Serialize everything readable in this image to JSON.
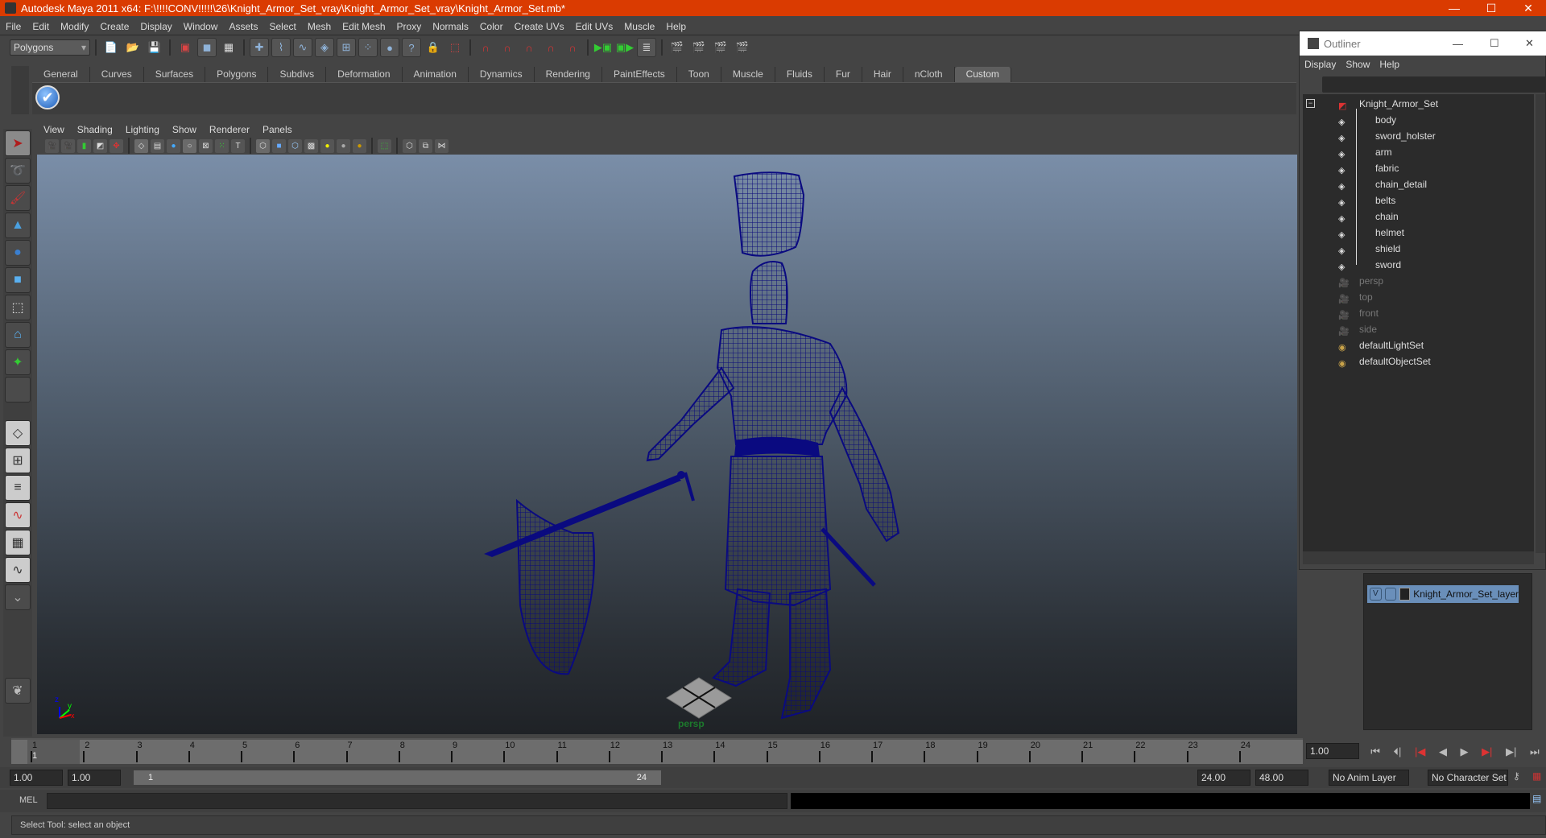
{
  "window": {
    "title": "Autodesk Maya 2011 x64: F:\\!!!!CONV!!!!!\\26\\Knight_Armor_Set_vray\\Knight_Armor_Set_vray\\Knight_Armor_Set.mb*",
    "minimize": "—",
    "maximize": "☐",
    "close": "✕"
  },
  "menubar": [
    "File",
    "Edit",
    "Modify",
    "Create",
    "Display",
    "Window",
    "Assets",
    "Select",
    "Mesh",
    "Edit Mesh",
    "Proxy",
    "Normals",
    "Color",
    "Create UVs",
    "Edit UVs",
    "Muscle",
    "Help"
  ],
  "toolbar": {
    "mode_select": "Polygons",
    "icons": [
      "new-scene",
      "open-scene",
      "save-scene",
      "select-by-hierarchy",
      "select-by-object-type",
      "select-by-component-type",
      "snap-to-grids",
      "snap-to-curves",
      "snap-to-points",
      "snap-to-view-planes",
      "make-live",
      "history",
      "render-current",
      "ipr-render",
      "render-settings",
      "hypershade"
    ]
  },
  "shelf": {
    "tabs": [
      "General",
      "Curves",
      "Surfaces",
      "Polygons",
      "Subdivs",
      "Deformation",
      "Animation",
      "Dynamics",
      "Rendering",
      "PaintEffects",
      "Toon",
      "Muscle",
      "Fluids",
      "Fur",
      "Hair",
      "nCloth",
      "Custom"
    ],
    "active_tab": "Custom"
  },
  "toolbox": [
    "select-tool",
    "lasso-tool",
    "paint-select-tool",
    "last-used-tool",
    "rotate-tool",
    "scale-tool",
    "universal-manipulator",
    "soft-modification",
    "show-manipulator",
    "empty-slot"
  ],
  "layouts": [
    "single-perspective",
    "four-view",
    "persp-outliner",
    "persp-graph",
    "hypershade-persp",
    "persp-graph-hypergraph",
    "more-layouts"
  ],
  "viewport": {
    "menus": [
      "View",
      "Shading",
      "Lighting",
      "Show",
      "Renderer",
      "Panels"
    ],
    "camera_label": "persp",
    "axis": {
      "x": "x",
      "y": "y",
      "z": "z"
    }
  },
  "timeline": {
    "ticks": [
      "1",
      "2",
      "3",
      "4",
      "5",
      "6",
      "7",
      "8",
      "9",
      "10",
      "11",
      "12",
      "13",
      "14",
      "15",
      "16",
      "17",
      "18",
      "19",
      "20",
      "21",
      "22",
      "23",
      "24"
    ],
    "current_marker": "1",
    "current_frame": "1.00",
    "playback_buttons": [
      "go-to-start",
      "step-back-key",
      "step-back-frame",
      "play-backwards",
      "play-forwards",
      "step-forward-frame",
      "step-forward-key",
      "go-to-end"
    ]
  },
  "range": {
    "start_time": "1.00",
    "playback_start": "1.00",
    "slider_start": "1",
    "slider_end": "24",
    "playback_end": "24.00",
    "end_time": "48.00",
    "anim_layer": "No Anim Layer",
    "character_set": "No Character Set"
  },
  "command_line": {
    "label": "MEL"
  },
  "help_line": "Select Tool: select an object",
  "outliner": {
    "title": "Outliner",
    "menus": [
      "Display",
      "Show",
      "Help"
    ],
    "root": "Knight_Armor_Set",
    "children": [
      "body",
      "sword_holster",
      "arm",
      "fabric",
      "chain_detail",
      "belts",
      "chain",
      "helmet",
      "shield",
      "sword"
    ],
    "cameras": [
      "persp",
      "top",
      "front",
      "side"
    ],
    "sets": [
      "defaultLightSet",
      "defaultObjectSet"
    ]
  },
  "layers": {
    "items": [
      {
        "visible": "V",
        "name": "Knight_Armor_Set_layer"
      }
    ],
    "selected_color": "#6a8fba"
  }
}
